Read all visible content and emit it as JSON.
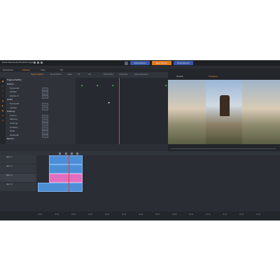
{
  "menu": [
    "Datei",
    "Bearbeiten",
    "Einstellungen"
  ],
  "topbuttons": [
    "Importieren",
    "Bearbeiten",
    "Exportieren"
  ],
  "left_tabs": [
    "Bibliothek",
    "Effekte",
    "Titel",
    "Filt"
  ],
  "editor_tabs": [
    "Eigenschaften",
    "Kanal-Editor",
    "Video",
    "FX",
    "3D",
    "Titel-Editor",
    "Untertitel",
    "Stereoskopisch"
  ],
  "preview_tabs": [
    "Quelle",
    "Timeline"
  ],
  "section_title": "Eigenschaften",
  "properties": [
    {
      "label": "Position",
      "group": true
    },
    {
      "label": "Horizontal",
      "group": false
    },
    {
      "label": "Vertikal",
      "group": false
    },
    {
      "label": "Position Z",
      "group": false
    },
    {
      "label": "Größe",
      "group": true
    },
    {
      "label": "Horizontal",
      "group": false
    },
    {
      "label": "Vertikal",
      "group": false
    },
    {
      "label": "Drehung",
      "group": true
    },
    {
      "label": "Drehen",
      "group": false
    },
    {
      "label": "Neigung",
      "group": false
    },
    {
      "label": "Drehung",
      "group": false
    },
    {
      "label": "Schatten",
      "group": false
    },
    {
      "label": "Farbe",
      "group": false
    },
    {
      "label": "Deckkraft",
      "group": false
    },
    {
      "label": "Bereich",
      "group": true
    }
  ],
  "tracks": [
    "Spur 1",
    "Spur 2",
    "Spur 3",
    "Spur 4"
  ],
  "ruler_ticks": [
    "00:00",
    "00:01",
    "00:02",
    "00:03",
    "00:04",
    "00:05",
    "00:06",
    "00:07",
    "00:08",
    "00:09",
    "00:10",
    "00:11",
    "00:12",
    "00:13"
  ],
  "colors": {
    "accent": "#f08c2a",
    "clip": "#4c8fd6",
    "playhead": "#e03a3a"
  }
}
